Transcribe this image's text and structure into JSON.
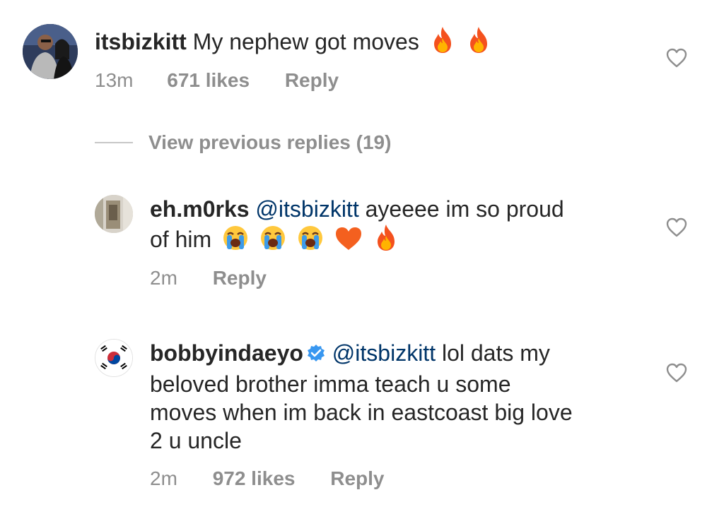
{
  "comments": [
    {
      "username": "itsbizkitt",
      "text": "My nephew got moves",
      "emojis": [
        "fire-icon",
        "fire-icon"
      ],
      "time": "13m",
      "likes": "671 likes",
      "reply_label": "Reply"
    },
    {
      "username": "eh.m0rks",
      "mention": "@itsbizkitt",
      "text_line1": "ayeeee im so proud",
      "text_line2": "of him",
      "emojis": [
        "loudly-crying-face-icon",
        "loudly-crying-face-icon",
        "loudly-crying-face-icon",
        "orange-heart-icon",
        "fire-icon"
      ],
      "time": "2m",
      "reply_label": "Reply"
    },
    {
      "username": "bobbyindaeyo",
      "verified": true,
      "mention": "@itsbizkitt",
      "text_line1": "lol dats my",
      "text_line2": "beloved brother imma teach u some",
      "text_line3": "moves when im back in eastcoast big love",
      "text_line4": "2 u uncle",
      "time": "2m",
      "likes": "972 likes",
      "reply_label": "Reply"
    }
  ],
  "view_previous_replies": "View previous replies (19)",
  "colors": {
    "text": "#262626",
    "mention": "#003569",
    "meta": "#8e8e8e",
    "verified": "#3897f0"
  }
}
